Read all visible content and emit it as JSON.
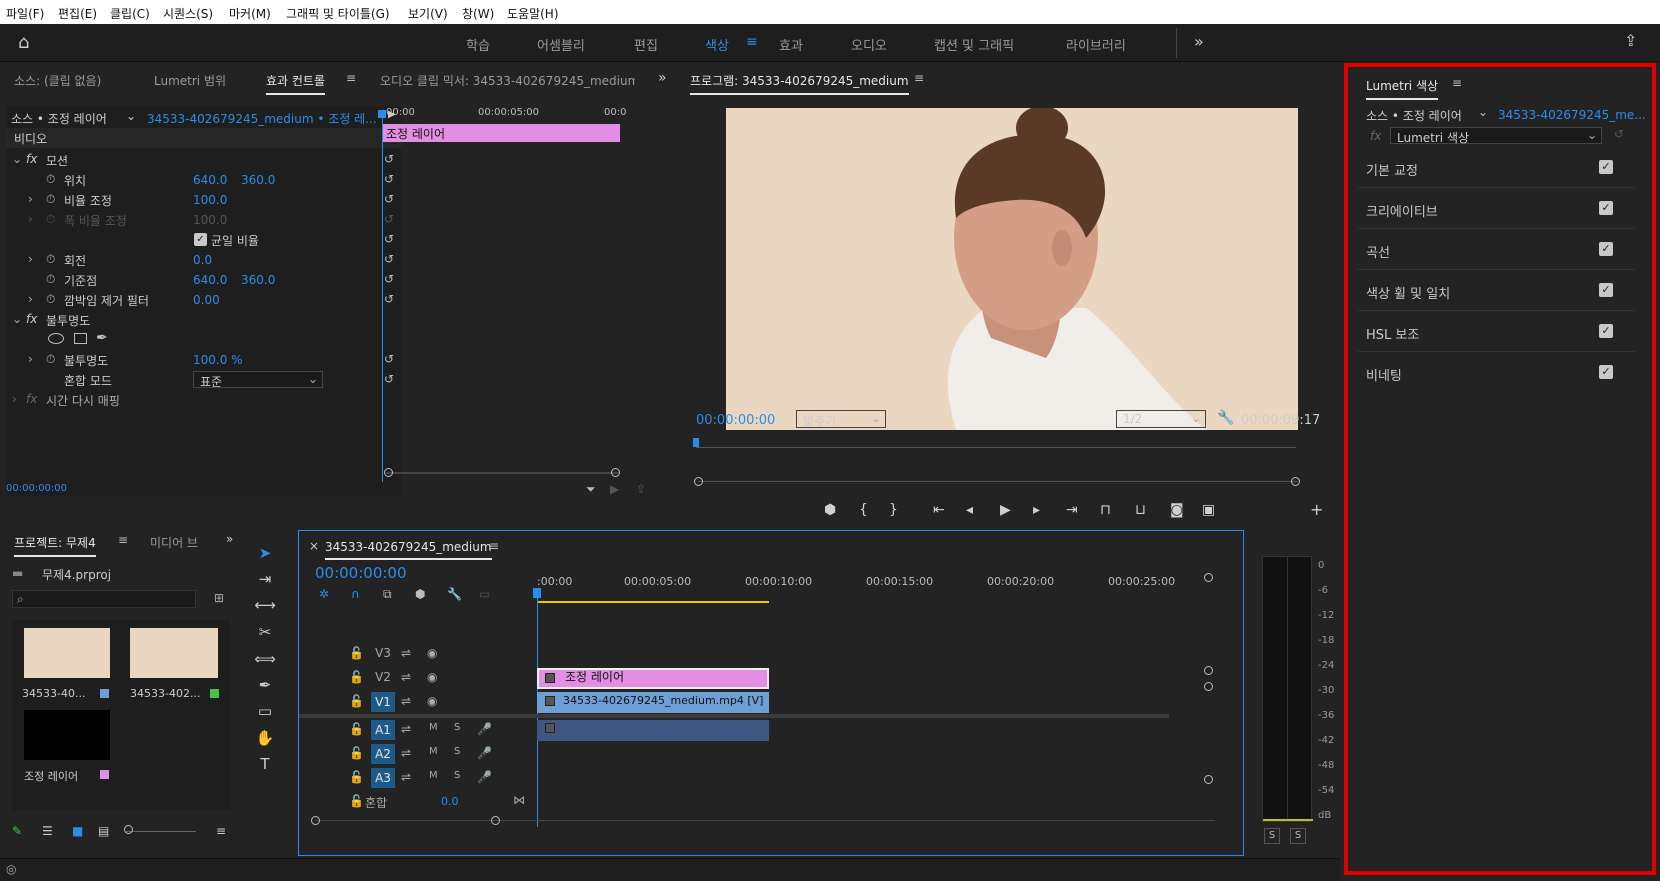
{
  "menu": [
    "파일(F)",
    "편집(E)",
    "클립(C)",
    "시퀀스(S)",
    "마커(M)",
    "그래픽 및 타이틀(G)",
    "보기(V)",
    "창(W)",
    "도움말(H)"
  ],
  "workspaces": [
    "학습",
    "어셈블리",
    "편집",
    "색상",
    "효과",
    "오디오",
    "캡션 및 그래픽",
    "라이브러리"
  ],
  "effect_panel": {
    "tabs": [
      "소스: (클립 없음)",
      "Lumetri 범위",
      "효과 컨트롤",
      "오디오 클립 믹서: 34533-402679245_medium"
    ],
    "source_label": "소스 • 조정 레이어",
    "source_clip": "34533-402679245_medium • 조정 레...",
    "ruler": [
      "00:00",
      "00:00:05:00",
      "00:0"
    ],
    "clip_label": "조정 레이어",
    "video_label": "비디오",
    "motion": "모션",
    "position_label": "위치",
    "position_x": "640.0",
    "position_y": "360.0",
    "scale_label": "비율 조정",
    "scale_val": "100.0",
    "scale_w_label": "폭 비율 조정",
    "scale_w_val": "100.0",
    "uniform_label": "균일 비율",
    "rotation_label": "회전",
    "rotation_val": "0.0",
    "anchor_label": "기준점",
    "anchor_x": "640.0",
    "anchor_y": "360.0",
    "flicker_label": "깜박임 제거 필터",
    "flicker_val": "0.00",
    "opacity_section": "불투명도",
    "opacity_label": "불투명도",
    "opacity_val": "100.0 %",
    "blend_label": "혼합 모드",
    "blend_val": "표준",
    "timeremap": "시간 다시 매핑",
    "timecode": "00:00:00:00"
  },
  "program": {
    "title": "프로그램: 34533-402679245_medium",
    "timecode": "00:00:00:00",
    "fit": "맞추기",
    "quality": "1/2",
    "duration": "00:00:09:17"
  },
  "project": {
    "tabs": [
      "프로젝트: 무제4",
      "미디어 브"
    ],
    "file": "무제4.prproj",
    "items": [
      "34533-40...",
      "34533-402...",
      "조정 레이어"
    ]
  },
  "timeline": {
    "tab": "34533-402679245_medium",
    "timecode": "00:00:00:00",
    "ruler": [
      ":00:00",
      "00:00:05:00",
      "00:00:10:00",
      "00:00:15:00",
      "00:00:20:00",
      "00:00:25:00"
    ],
    "tracks": [
      "V3",
      "V2",
      "V1",
      "A1",
      "A2",
      "A3"
    ],
    "mix_label": "혼합",
    "mix_val": "0.0",
    "clip_adj": "조정 레이어",
    "clip_video": "34533-402679245_medium.mp4 [V]"
  },
  "meter": {
    "labels": [
      "0",
      "-6",
      "-12",
      "-18",
      "-24",
      "-30",
      "-36",
      "-42",
      "-48",
      "-54",
      "dB"
    ],
    "solo": [
      "S",
      "S"
    ]
  },
  "lumetri": {
    "title": "Lumetri 색상",
    "source": "소스 • 조정 레이어",
    "clip": "34533-402679245_me...",
    "effect": "Lumetri 색상",
    "sections": [
      "기본 교정",
      "크리에이티브",
      "곡선",
      "색상 휠 및 일치",
      "HSL 보조",
      "비네팅"
    ],
    "highlight_color": "#e00000"
  }
}
